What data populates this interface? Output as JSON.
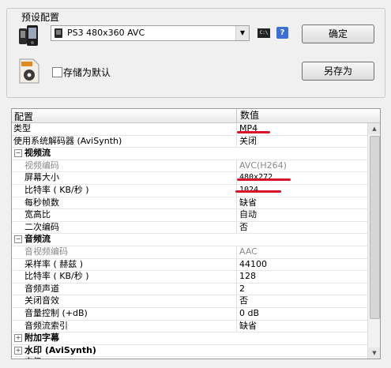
{
  "preset": {
    "group_title": "预设配置",
    "selected": "PS3 480x360 AVC",
    "confirm_label": "确定",
    "saveas_label": "另存为",
    "default_checkbox_label": "存储为默认",
    "default_checked": false,
    "help_label": "?"
  },
  "grid": {
    "col_name": "配置",
    "col_value": "数值",
    "rows": [
      {
        "name": "类型",
        "value": "MP4"
      },
      {
        "name": "使用系统解码器 (AviSynth)",
        "value": "关闭"
      },
      {
        "name": "视频流",
        "value": ""
      },
      {
        "name": "视频编码",
        "value": "AVC(H264)"
      },
      {
        "name": "屏幕大小",
        "value": "480x272"
      },
      {
        "name": "比特率 ( KB/秒 )",
        "value": "1024"
      },
      {
        "name": "每秒帧数",
        "value": "缺省"
      },
      {
        "name": "宽高比",
        "value": "自动"
      },
      {
        "name": "二次编码",
        "value": "否"
      },
      {
        "name": "音频流",
        "value": ""
      },
      {
        "name": "音视频编码",
        "value": "AAC"
      },
      {
        "name": "采样率 ( 赫兹 )",
        "value": "44100"
      },
      {
        "name": "比特率 ( KB/秒 )",
        "value": "128"
      },
      {
        "name": "音频声道",
        "value": "2"
      },
      {
        "name": "关闭音效",
        "value": "否"
      },
      {
        "name": "音量控制 (+dB)",
        "value": "0 dB"
      },
      {
        "name": "音频流索引",
        "value": "缺省"
      },
      {
        "name": "附加字幕",
        "value": ""
      },
      {
        "name": "水印 (AviSynth)",
        "value": ""
      },
      {
        "name": "高级",
        "value": ""
      }
    ]
  },
  "colors": {
    "annotation_red": "#d9142a"
  }
}
